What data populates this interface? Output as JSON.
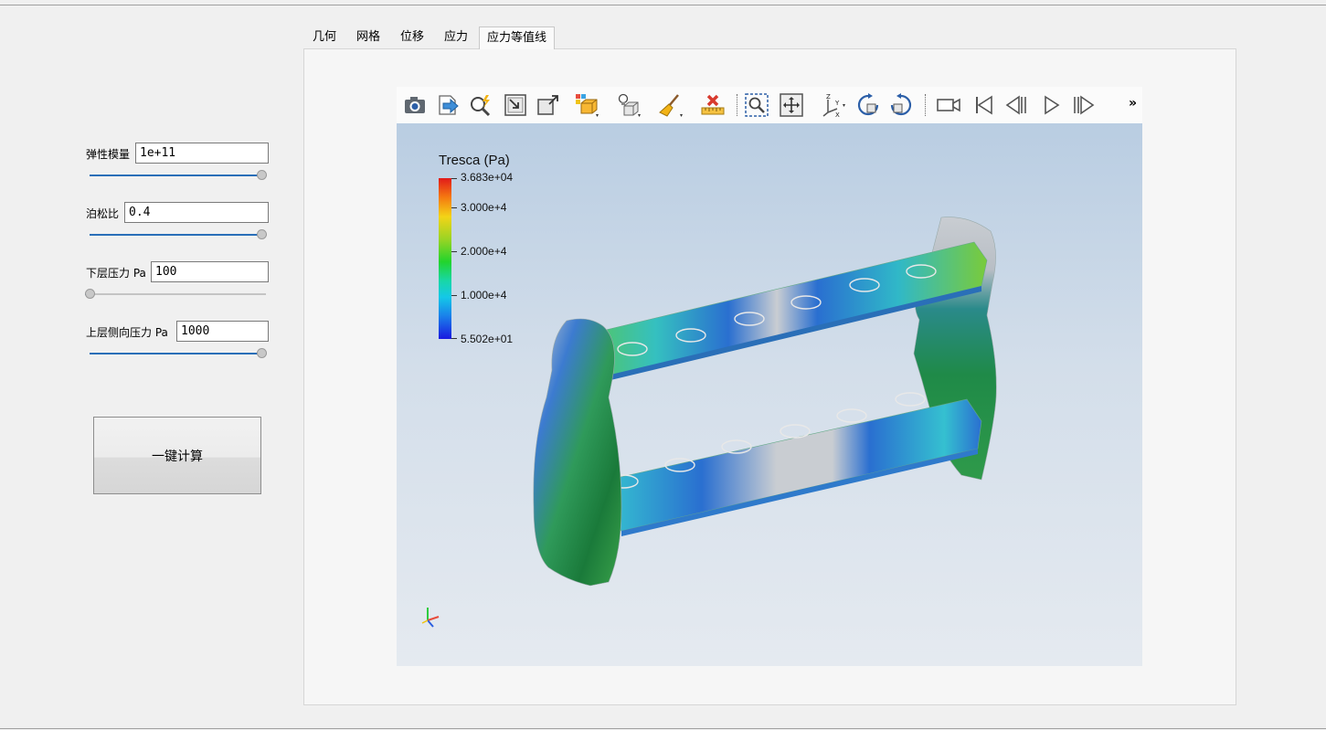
{
  "tabs": [
    {
      "label": "几何"
    },
    {
      "label": "网格"
    },
    {
      "label": "位移"
    },
    {
      "label": "应力"
    },
    {
      "label": "应力等值线"
    }
  ],
  "active_tab": "应力等值线",
  "params": {
    "elastic_modulus": {
      "label": "弹性模量",
      "value": "1e+11",
      "slider_fraction": 1.0
    },
    "poisson_ratio": {
      "label": "泊松比",
      "value": "0.4",
      "slider_fraction": 1.0
    },
    "lower_pressure": {
      "label": "下层压力 Pa",
      "value": "100",
      "slider_fraction": 0.0
    },
    "upper_side_pressure": {
      "label": "上层侧向压力  Pa",
      "value": "1000",
      "slider_fraction": 1.0
    }
  },
  "calc_button": {
    "label": "一键计算"
  },
  "toolbar": {
    "buttons": [
      "camera-icon",
      "export-icon",
      "zoom-to-data-icon",
      "reset-camera-icon",
      "zoom-closest-icon",
      "toggle-color-legend-icon",
      "light-icon",
      "clear-icon",
      "ruler-icon",
      "zoom-to-box-icon",
      "pan-icon",
      "axes-orientation-icon",
      "rotate-cw-icon",
      "rotate-ccw-icon",
      "record-camera-icon",
      "first-frame-icon",
      "previous-frame-icon",
      "play-icon",
      "next-frame-icon"
    ],
    "more": "»"
  },
  "legend": {
    "title": "Tresca (Pa)",
    "labels": [
      "3.683e+04",
      "3.000e+4",
      "2.000e+4",
      "1.000e+4",
      "5.502e+01"
    ],
    "colors": {
      "max": "#e21a1a",
      "mid": "#22d42c",
      "min": "#1a1ae0"
    }
  },
  "colors": {
    "accent": "#2a6fb8",
    "model_gray": "#c9cdd2"
  }
}
